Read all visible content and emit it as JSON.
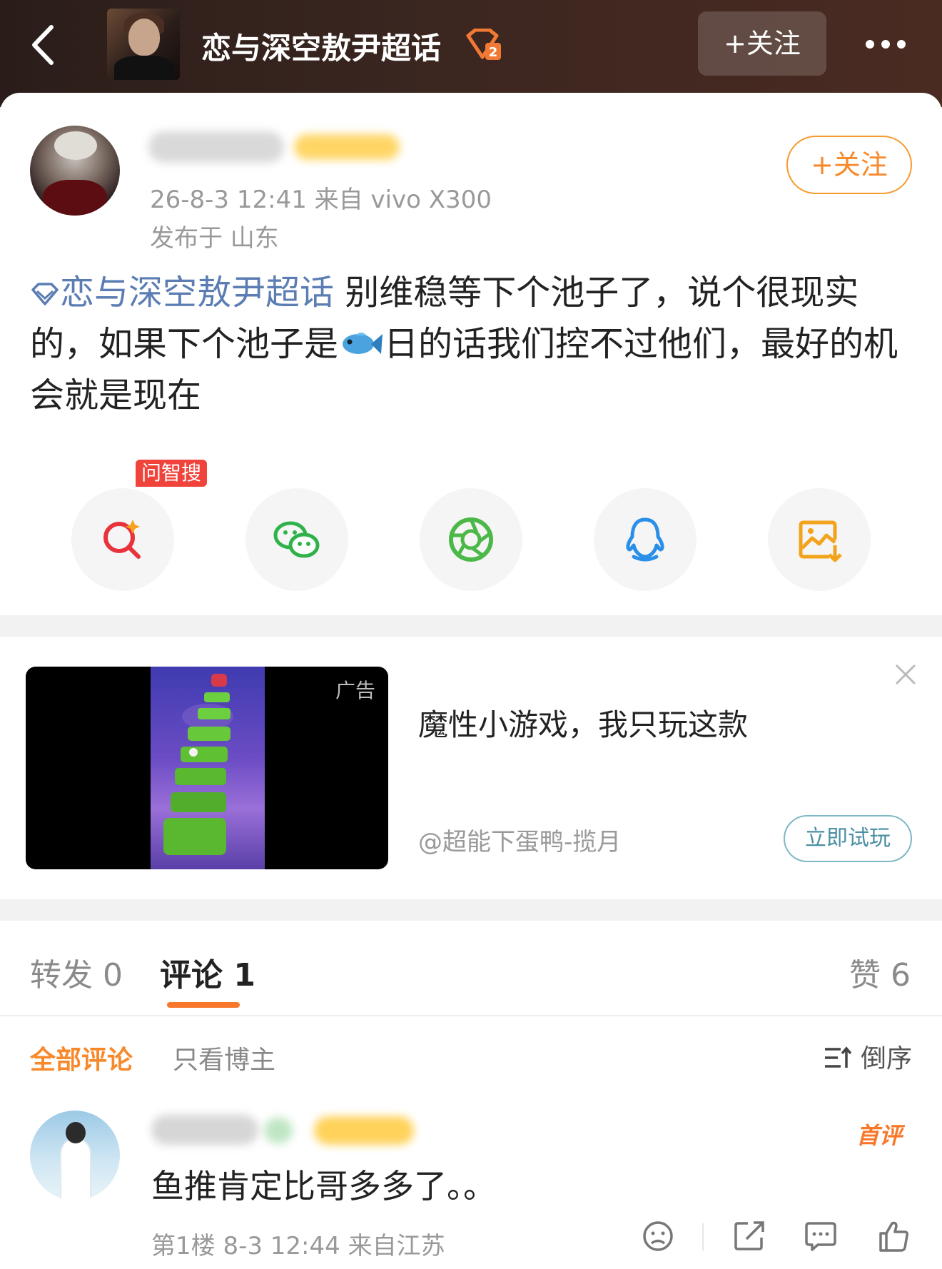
{
  "header": {
    "back_icon": "chevron-left-icon",
    "topic_title": "恋与深空敖尹超话",
    "topic_badge_level": "2",
    "follow_label": "+关注",
    "more_icon": "more-dots-icon"
  },
  "post": {
    "meta": "26-8-3 12:41  来自 vivo X300",
    "location": "发布于 山东",
    "follow_label": "+关注",
    "topic_link": "恋与深空敖尹超话",
    "text_part1": " 别维稳等下个池子了，说个很现实的，如果下个池子是",
    "text_part2": "日的话我们控不过他们，最好的机会就是现在",
    "share": {
      "ai_tag": "问智搜",
      "items": [
        "ai-search-icon",
        "wechat-icon",
        "moments-icon",
        "qq-icon",
        "save-image-icon"
      ]
    }
  },
  "ad": {
    "tag": "广告",
    "title": "魔性小游戏，我只玩这款",
    "source": "@超能下蛋鸭-揽月",
    "cta": "立即试玩"
  },
  "comments": {
    "tabs": {
      "repost": "转发 0",
      "comment": "评论 1",
      "like": "赞 6"
    },
    "filters": {
      "all": "全部评论",
      "author_only": "只看博主",
      "sort": "倒序"
    },
    "items": [
      {
        "label": "首评",
        "text": "鱼推肯定比哥多多了。。",
        "meta": "第1楼 8-3 12:44 来自江苏"
      }
    ]
  },
  "colors": {
    "accent_orange": "#f7892b",
    "topic_blue": "#5b7db3",
    "header_bg": "#3b2620"
  }
}
